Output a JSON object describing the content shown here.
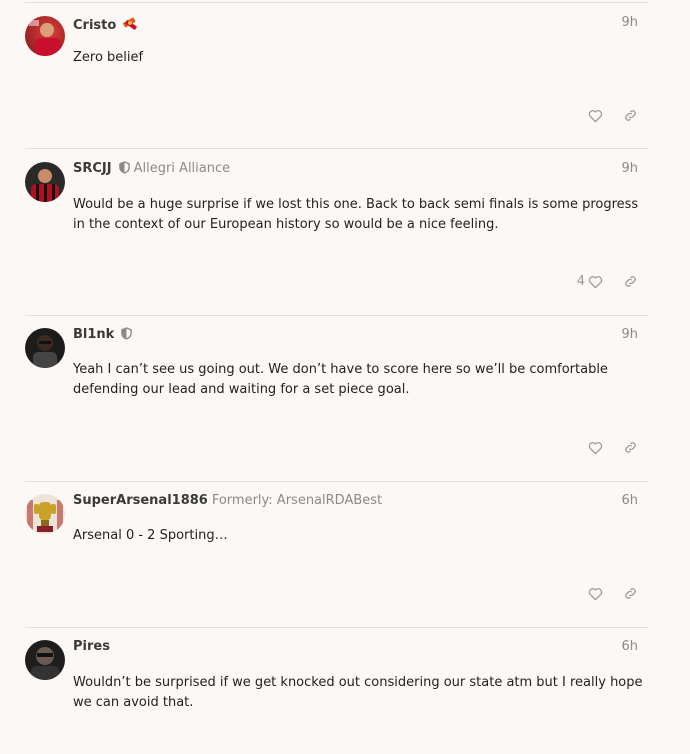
{
  "posts": [
    {
      "username": "Cristo",
      "subtitle": "",
      "time": "9h",
      "body": "Zero belief",
      "likes": "",
      "flair_icon": "ribbon-flair-icon",
      "avatar_colors": [
        "#c8102e",
        "#7a1a1a"
      ]
    },
    {
      "username": "SRCJJ",
      "subtitle": "Allegri Alliance",
      "time": "9h",
      "body": "Would be a huge surprise if we lost this one. Back to back semi finals is some progress in the context of our European history so would be a nice feeling.",
      "likes": "4",
      "flair_icon": "shield-icon",
      "avatar_colors": [
        "#b01020",
        "#2a2a2a"
      ]
    },
    {
      "username": "Bl1nk",
      "subtitle": "",
      "time": "9h",
      "body": "Yeah I can’t see us going out. We don’t have to score here so we’ll be comfortable defending our lead and waiting for a set piece goal.",
      "likes": "",
      "flair_icon": "shield-icon",
      "avatar_colors": [
        "#1c1c1c",
        "#4a4a4a"
      ]
    },
    {
      "username": "SuperArsenal1886",
      "subtitle": "Formerly: ArsenalRDABest",
      "time": "6h",
      "body": "Arsenal 0 - 2 Sporting…",
      "likes": "",
      "flair_icon": "",
      "avatar_colors": [
        "#c9a227",
        "#8a1f2a"
      ]
    },
    {
      "username": "Pires",
      "subtitle": "",
      "time": "6h",
      "body": "Wouldn’t be surprised if we get knocked out considering our state atm but I really hope we can avoid that.",
      "likes": "",
      "flair_icon": "",
      "avatar_colors": [
        "#2a2a2a",
        "#6a5a50"
      ]
    }
  ]
}
